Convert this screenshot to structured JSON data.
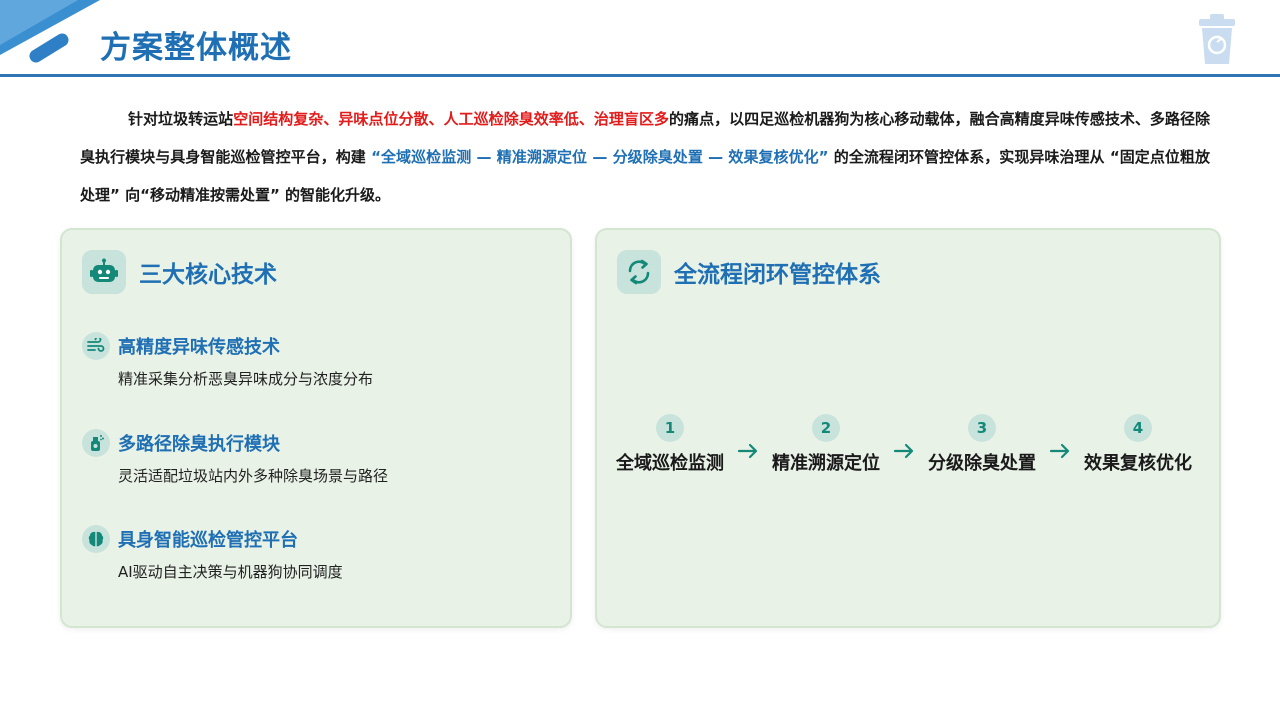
{
  "header": {
    "title": "方案整体概述"
  },
  "intro": {
    "p1": "针对垃圾转运站",
    "pain_points": "空间结构复杂、异味点位分散、人工巡检除臭效率低、治理盲区多",
    "p2": "的痛点，以四足巡检机器狗为核心移动载体，融合高精度异味传感技术、多路径除臭执行模块与具身智能巡检管控平台，构建 ",
    "process_quote": "“全域巡检监测 — 精准溯源定位 — 分级除臭处置 — 效果复核优化”",
    "p3": " 的全流程闭环管控体系，实现异味治理从 “固定点位粗放处理” 向“移动精准按需处置” 的智能化升级。"
  },
  "left_card": {
    "title": "三大核心技术",
    "icon": "robot-icon",
    "items": [
      {
        "icon": "wind-icon",
        "name": "高精度异味传感技术",
        "desc": "精准采集分析恶臭异味成分与浓度分布"
      },
      {
        "icon": "spray-icon",
        "name": "多路径除臭执行模块",
        "desc": "灵活适配垃圾站内外多种除臭场景与路径"
      },
      {
        "icon": "brain-icon",
        "name": "具身智能巡检管控平台",
        "desc": "AI驱动自主决策与机器狗协同调度"
      }
    ]
  },
  "right_card": {
    "title": "全流程闭环管控体系",
    "icon": "cycle-arrows-icon",
    "steps": [
      {
        "num": "1",
        "label": "全域巡检监测"
      },
      {
        "num": "2",
        "label": "精准溯源定位"
      },
      {
        "num": "3",
        "label": "分级除臭处置"
      },
      {
        "num": "4",
        "label": "效果复核优化"
      }
    ]
  },
  "colors": {
    "accent": "#1f6fb4",
    "highlight": "#e21b1b",
    "teal": "#14897a",
    "card_bg": "#e9f2e7"
  }
}
